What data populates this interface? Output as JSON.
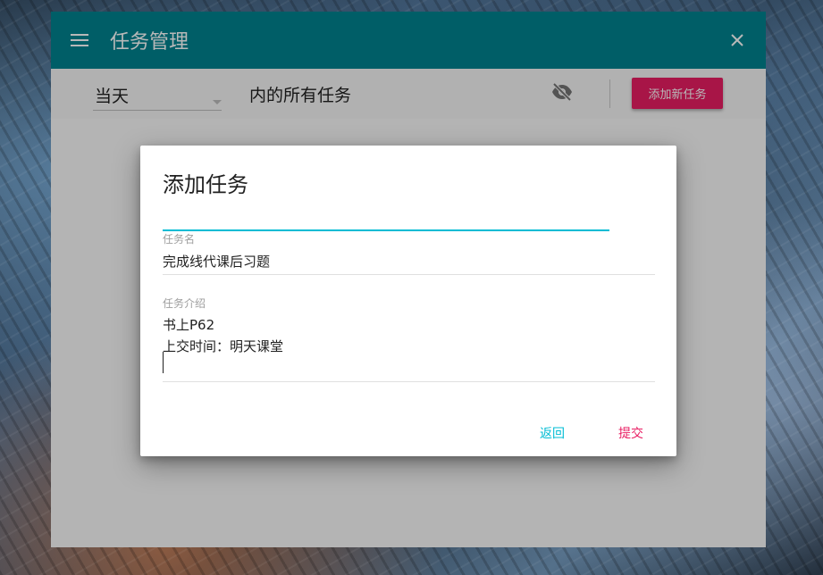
{
  "colors": {
    "appbar": "#00838f",
    "accent_pink": "#e91e63",
    "accent_cyan": "#00bcd4"
  },
  "appbar": {
    "title": "任务管理",
    "menu_icon": "menu-icon",
    "close_icon": "close-icon"
  },
  "toolbar": {
    "period_value": "当天",
    "suffix_text": "内的所有任务",
    "visibility_icon": "visibility-off-icon",
    "add_label": "添加新任务"
  },
  "dialog": {
    "title": "添加任务",
    "name_label": "任务名",
    "name_value": "完成线代课后习题",
    "desc_label": "任务介绍",
    "desc_lines": [
      "书上P62",
      "上交时间：明天课堂"
    ],
    "back_label": "返回",
    "submit_label": "提交"
  }
}
